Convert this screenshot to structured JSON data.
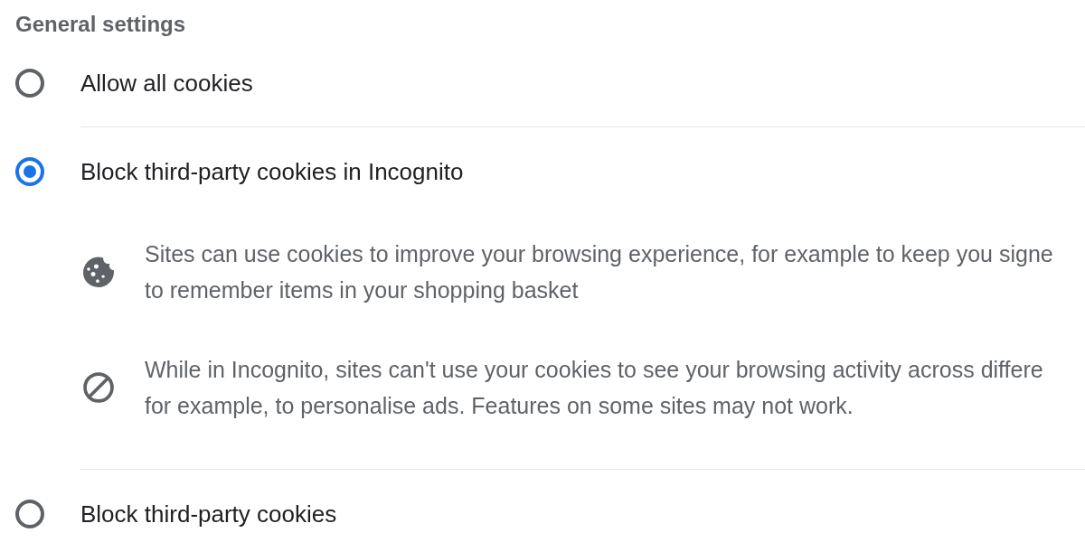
{
  "section": {
    "title": "General settings"
  },
  "options": [
    {
      "label": "Allow all cookies",
      "selected": false
    },
    {
      "label": "Block third-party cookies in Incognito",
      "selected": true,
      "details": [
        {
          "lines": [
            "Sites can use cookies to improve your browsing experience, for example to keep you signe",
            "to remember items in your shopping basket"
          ]
        },
        {
          "lines": [
            "While in Incognito, sites can't use your cookies to see your browsing activity across differe",
            "for example, to personalise ads. Features on some sites may not work."
          ]
        }
      ]
    },
    {
      "label": "Block third-party cookies",
      "selected": false
    }
  ]
}
